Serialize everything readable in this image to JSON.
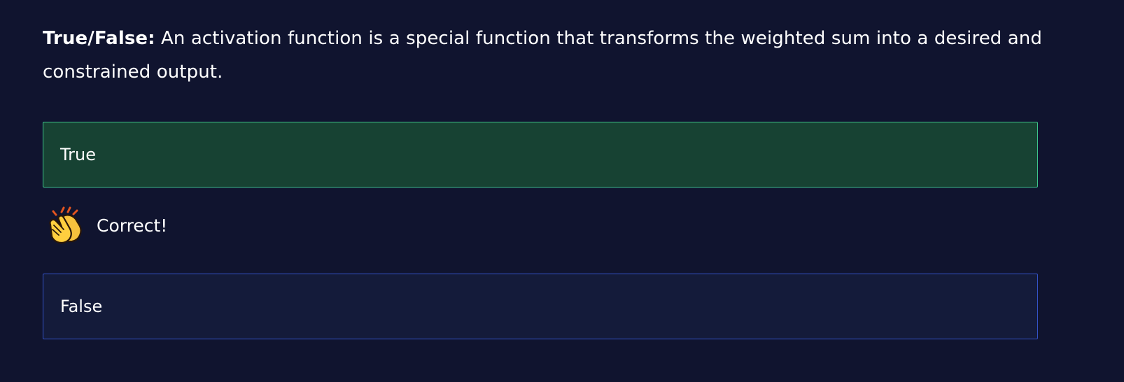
{
  "question": {
    "prefix": "True/False:",
    "text": " An activation function is a special function that transforms the weighted sum into a desired and constrained output."
  },
  "options": [
    {
      "label": "True",
      "state": "correct"
    },
    {
      "label": "False",
      "state": "unselected"
    }
  ],
  "feedback": {
    "icon": "clapping-hands-icon",
    "text": "Correct!"
  },
  "colors": {
    "background": "#10142f",
    "correct_fill": "#174233",
    "correct_border": "#3fc48d",
    "option_fill": "#141b3a",
    "option_border": "#3353c9",
    "text": "#ffffff"
  }
}
